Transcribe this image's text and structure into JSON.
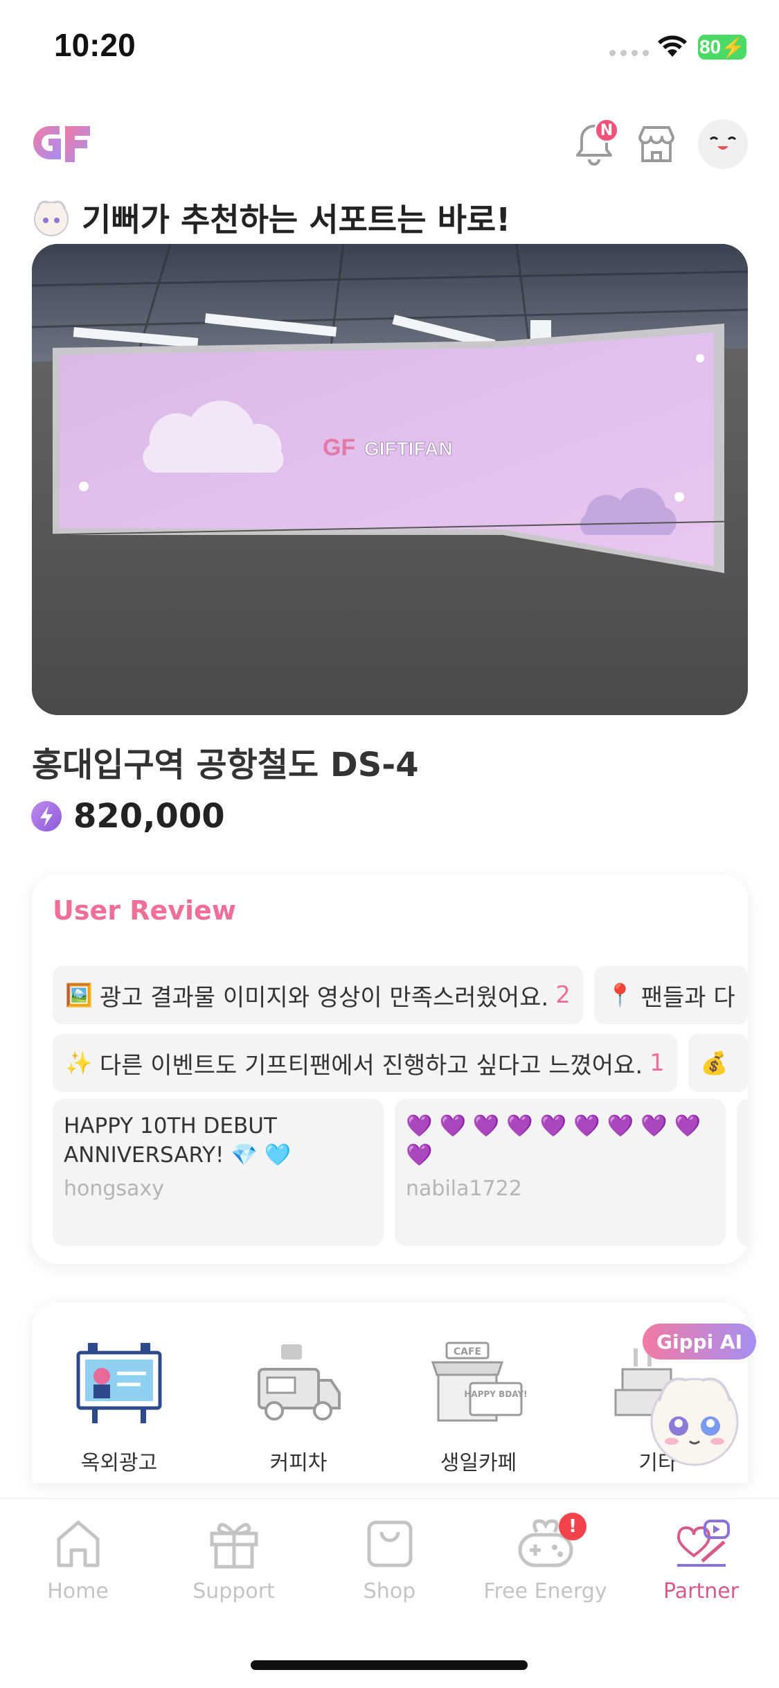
{
  "status_bar": {
    "time": "10:20",
    "battery": "80"
  },
  "header": {
    "logo_text": "GF",
    "notification_badge": "N"
  },
  "recommendation": {
    "title": "기뻐가 추천하는 서포트는 바로!",
    "banner_brand": "GIFTIFAN",
    "place_name": "홍대입구역 공항철도 DS-4",
    "price": "820,000"
  },
  "reviews": {
    "heading": "User Review",
    "row1": [
      {
        "emoji": "🖼️",
        "text": "광고 결과물 이미지와 영상이 만족스러웠어요.",
        "count": "2"
      },
      {
        "emoji": "📍",
        "text": "팬들과 다",
        "count": ""
      }
    ],
    "row2": [
      {
        "emoji": "✨",
        "text": "다른 이벤트도 기프티팬에서 진행하고 싶다고 느꼈어요.",
        "count": "1"
      },
      {
        "emoji": "💰",
        "text": "",
        "count": ""
      }
    ],
    "comments": [
      {
        "text": "HAPPY 10TH DEBUT ANNIVERSARY! 💎 🩵",
        "user": "hongsaxy"
      },
      {
        "text": "💜 💜 💜 💜 💜 💜 💜 💜 💜 💜",
        "user": "nabila1722"
      }
    ]
  },
  "categories": [
    {
      "label": "옥외광고",
      "icon": "billboard-icon"
    },
    {
      "label": "커피차",
      "icon": "coffee-truck-icon"
    },
    {
      "label": "생일카페",
      "icon": "birthday-cafe-icon",
      "sign_top": "CAFE",
      "sign_bottom": "HAPPY BDAY!"
    },
    {
      "label": "기타",
      "icon": "cake-icon"
    }
  ],
  "gippi_ai": {
    "label": "Gippi AI"
  },
  "bottom_nav": [
    {
      "label": "Home",
      "icon": "home-icon"
    },
    {
      "label": "Support",
      "icon": "gift-icon"
    },
    {
      "label": "Shop",
      "icon": "shopping-bag-icon"
    },
    {
      "label": "Free Energy",
      "icon": "gamepad-icon",
      "alert": "!"
    },
    {
      "label": "Partner",
      "icon": "partner-icon",
      "active": true
    }
  ],
  "colors": {
    "accent_pink": "#ef6f96",
    "accent_purple": "#a58ff2",
    "battery_green": "#4cd964"
  }
}
